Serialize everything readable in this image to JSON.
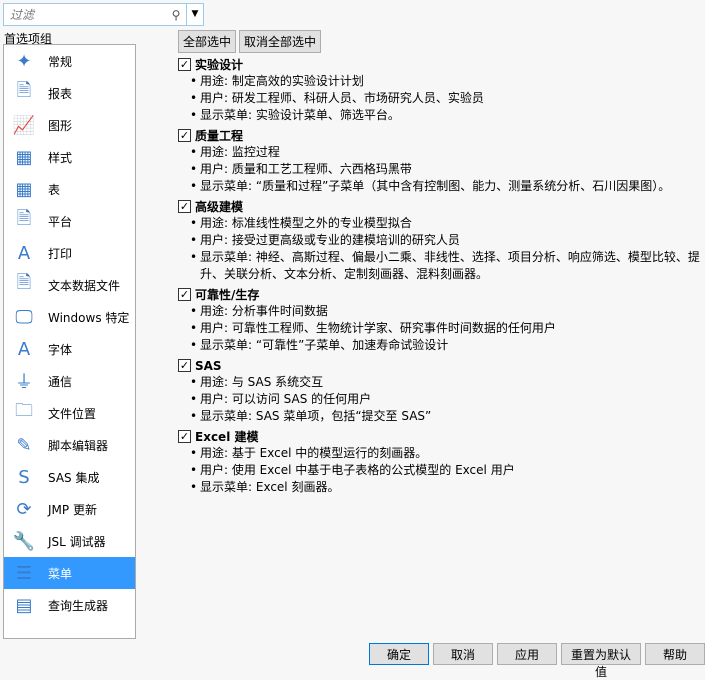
{
  "filter": {
    "placeholder": "过滤"
  },
  "group_label": "首选项组",
  "groups": [
    {
      "label": "常规",
      "icon": "jmp-man-icon",
      "glyph": "✦"
    },
    {
      "label": "报表",
      "icon": "report-icon",
      "glyph": "🗎"
    },
    {
      "label": "图形",
      "icon": "graph-icon",
      "glyph": "📈"
    },
    {
      "label": "样式",
      "icon": "styles-icon",
      "glyph": "▦"
    },
    {
      "label": "表",
      "icon": "table-icon",
      "glyph": "▦"
    },
    {
      "label": "平台",
      "icon": "platform-icon",
      "glyph": "🗎"
    },
    {
      "label": "打印",
      "icon": "print-icon",
      "glyph": "A"
    },
    {
      "label": "文本数据文件",
      "icon": "txt-file-icon",
      "glyph": "🗎"
    },
    {
      "label": "Windows 特定",
      "icon": "monitor-icon",
      "glyph": "🖵"
    },
    {
      "label": "字体",
      "icon": "font-icon",
      "glyph": "A"
    },
    {
      "label": "通信",
      "icon": "plug-icon",
      "glyph": "⏚"
    },
    {
      "label": "文件位置",
      "icon": "folder-icon",
      "glyph": "🗀"
    },
    {
      "label": "脚本编辑器",
      "icon": "script-editor-icon",
      "glyph": "✎"
    },
    {
      "label": "SAS 集成",
      "icon": "sas-icon",
      "glyph": "S"
    },
    {
      "label": "JMP 更新",
      "icon": "update-icon",
      "glyph": "⟳"
    },
    {
      "label": "JSL 调试器",
      "icon": "wrench-icon",
      "glyph": "🔧"
    },
    {
      "label": "菜单",
      "icon": "menu-icon",
      "glyph": "☰",
      "selected": true
    },
    {
      "label": "查询生成器",
      "icon": "query-builder-icon",
      "glyph": "▤"
    }
  ],
  "select_all": "全部选中",
  "deselect_all": "取消全部选中",
  "sections": [
    {
      "title": "实验设计",
      "checked": true,
      "lines": [
        "用途: 制定高效的实验设计计划",
        "用户: 研发工程师、科研人员、市场研究人员、实验员",
        "显示菜单: 实验设计菜单、筛选平台。"
      ]
    },
    {
      "title": "质量工程",
      "checked": true,
      "lines": [
        "用途: 监控过程",
        "用户: 质量和工艺工程师、六西格玛黑带",
        "显示菜单: “质量和过程”子菜单（其中含有控制图、能力、测量系统分析、石川因果图）。"
      ]
    },
    {
      "title": "高级建模",
      "checked": true,
      "lines": [
        "用途: 标准线性模型之外的专业模型拟合",
        "用户: 接受过更高级或专业的建模培训的研究人员",
        "显示菜单: 神经、高斯过程、偏最小二乘、非线性、选择、项目分析、响应筛选、模型比较、提升、关联分析、文本分析、定制刻画器、混料刻画器。"
      ]
    },
    {
      "title": "可靠性/生存",
      "checked": true,
      "lines": [
        "用途: 分析事件时间数据",
        "用户: 可靠性工程师、生物统计学家、研究事件时间数据的任何用户",
        "显示菜单: “可靠性”子菜单、加速寿命试验设计"
      ]
    },
    {
      "title": "SAS",
      "checked": true,
      "lines": [
        "用途: 与 SAS 系统交互",
        "用户: 可以访问 SAS 的任何用户",
        "显示菜单: SAS 菜单项，包括“提交至 SAS”"
      ]
    },
    {
      "title": "Excel 建模",
      "checked": true,
      "lines": [
        "用途: 基于 Excel 中的模型运行的刻画器。",
        "用户: 使用 Excel 中基于电子表格的公式模型的 Excel 用户",
        "显示菜单: Excel 刻画器。"
      ]
    }
  ],
  "buttons": {
    "ok": "确定",
    "cancel": "取消",
    "apply": "应用",
    "reset": "重置为默认值",
    "help": "帮助"
  }
}
